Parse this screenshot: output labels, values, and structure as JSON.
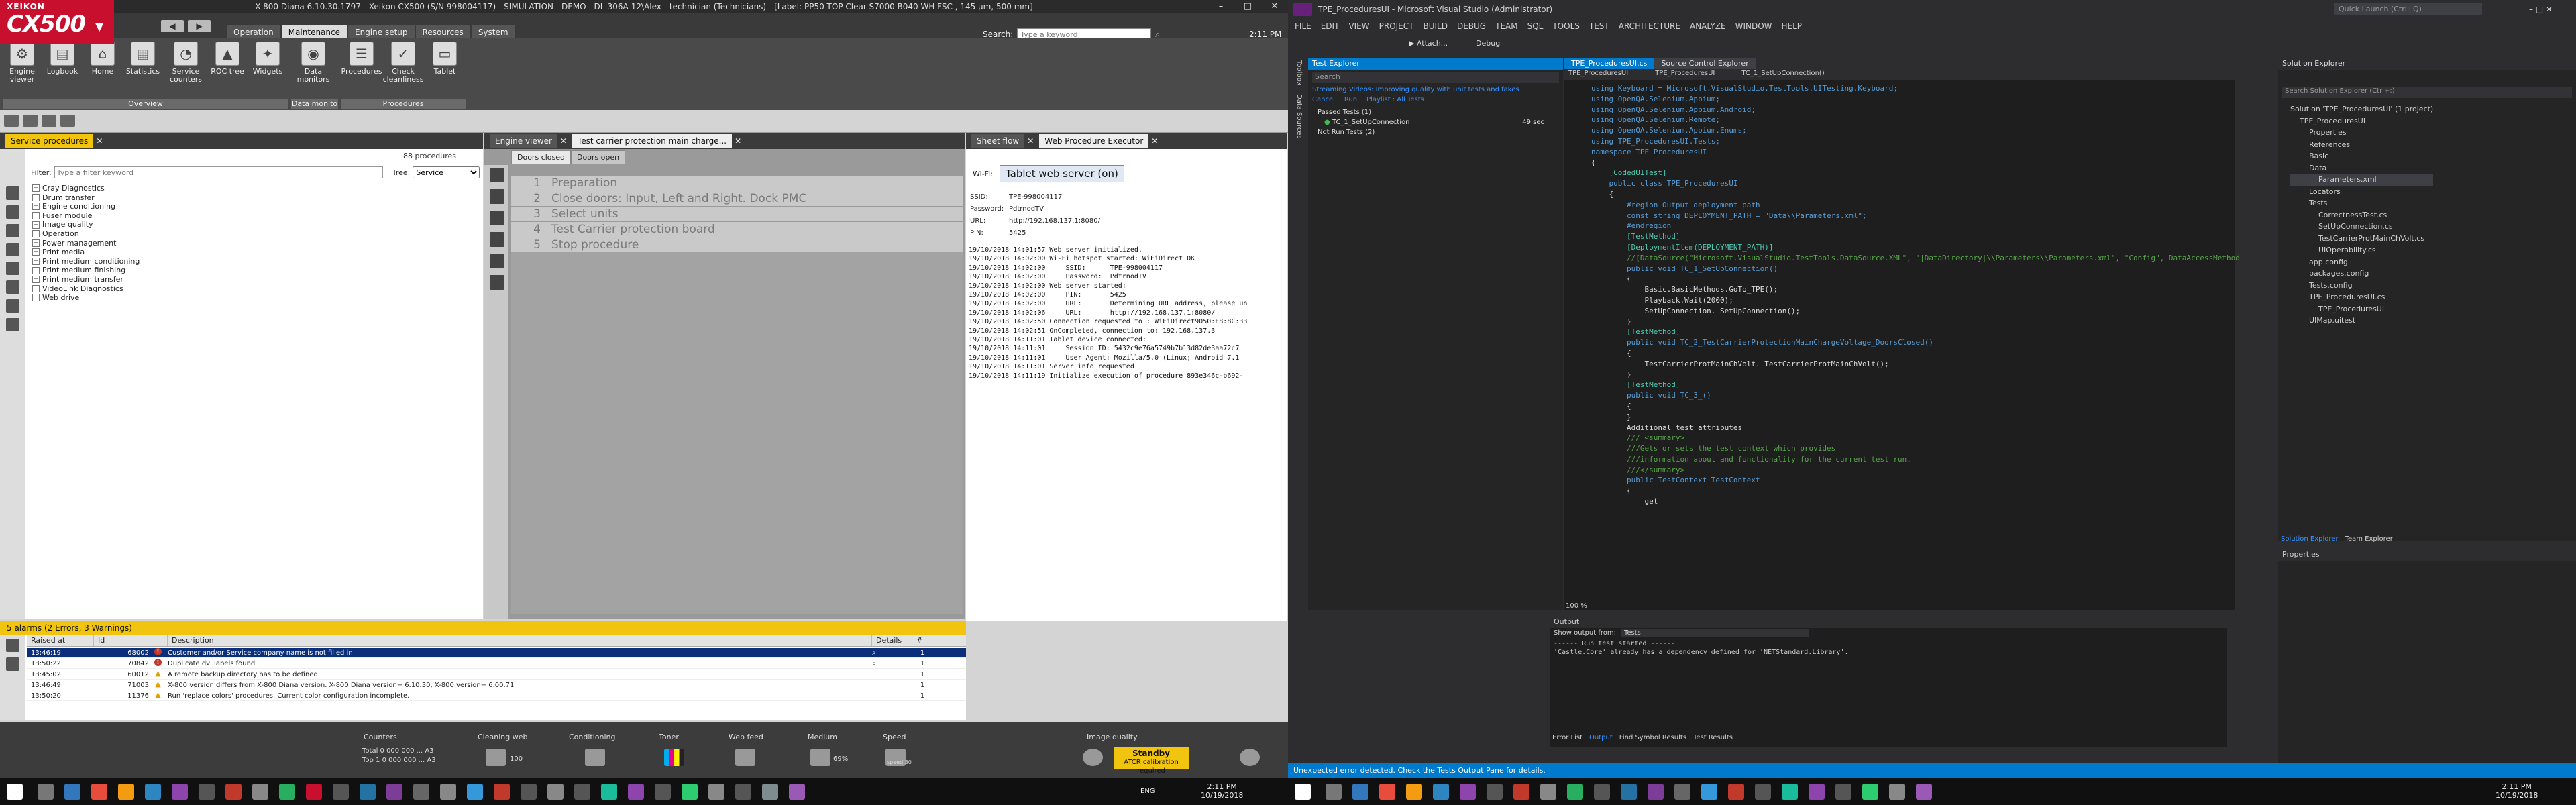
{
  "left_app": {
    "logo": {
      "brand": "XEIKON",
      "model": "CX500"
    },
    "title": "X-800 Diana 6.10.30.1797 - Xeikon CX500 (S/N 998004117) - SIMULATION - DEMO - DL-306A-12\\Alex - technician (Technicians) - [Label: PP50 TOP Clear S7000 B040 WH FSC , 145 µm, 500 mm]",
    "menu_tabs": [
      "Operation",
      "Maintenance",
      "Engine setup",
      "Resources",
      "System"
    ],
    "search_label": "Search:",
    "search_placeholder": "Type a keyword",
    "clock": "2:11 PM",
    "ribbon": [
      {
        "label": "Engine viewer",
        "icon": "engine-icon"
      },
      {
        "label": "Logbook",
        "icon": "logbook-icon"
      },
      {
        "label": "Home",
        "icon": "home-icon"
      },
      {
        "label": "Statistics",
        "icon": "statistics-icon"
      },
      {
        "label": "Service counters",
        "icon": "counter-icon"
      },
      {
        "label": "ROC tree",
        "icon": "tree-icon"
      },
      {
        "label": "Widgets",
        "icon": "widgets-icon"
      },
      {
        "label": "Data monitors",
        "icon": "monitor-icon"
      },
      {
        "label": "Procedures",
        "icon": "procedures-icon"
      },
      {
        "label": "Check cleanliness",
        "icon": "check-icon"
      },
      {
        "label": "Tablet",
        "icon": "tablet-icon"
      }
    ],
    "ribbon_groups": [
      "Overview",
      "Data monito",
      "Procedures"
    ],
    "service_panel": {
      "title": "Service procedures",
      "count": "88 procedures",
      "filter_label": "Filter:",
      "filter_placeholder": "Type a filter keyword",
      "tree_label": "Tree:",
      "tree_value": "Service",
      "items": [
        "Cray Diagnostics",
        "Drum transfer",
        "Engine conditioning",
        "Fuser module",
        "Image quality",
        "Operation",
        "Power management",
        "Print media",
        "Print medium conditioning",
        "Print medium finishing",
        "Print medium transfer",
        "VideoLink Diagnostics",
        "Web drive"
      ]
    },
    "engine_panel": {
      "tabs": [
        "Engine viewer",
        "Test carrier protection main charge..."
      ],
      "subtabs": [
        "Doors closed",
        "Doors open"
      ],
      "steps": [
        {
          "n": "1",
          "text": "Preparation"
        },
        {
          "n": "2",
          "text": "Close doors: Input, Left and Right. Dock PMC"
        },
        {
          "n": "3",
          "text": "Select units"
        },
        {
          "n": "4",
          "text": "Test Carrier protection board"
        },
        {
          "n": "5",
          "text": "Stop procedure"
        }
      ]
    },
    "web_panel": {
      "tabs": [
        "Sheet flow",
        "Web Procedure Executor"
      ],
      "wifi_label": "Wi-Fi:",
      "wifi_button": "Tablet web server (on)",
      "fields": [
        {
          "k": "SSID:",
          "v": "TPE-998004117"
        },
        {
          "k": "Password:",
          "v": "PdtrnodTV"
        },
        {
          "k": "URL:",
          "v": "http://192.168.137.1:8080/"
        },
        {
          "k": "PIN:",
          "v": "5425"
        }
      ],
      "log": [
        "19/10/2018 14:01:57 Web server initialized.",
        "19/10/2018 14:02:00 Wi-Fi hotspot started: WiFiDirect OK",
        "19/10/2018 14:02:00     SSID:      TPE-998004117",
        "19/10/2018 14:02:00     Password:  PdtrnodTV",
        "19/10/2018 14:02:00 Web server started:",
        "19/10/2018 14:02:00     PIN:       5425",
        "19/10/2018 14:02:00     URL:       Determining URL address, please un",
        "19/10/2018 14:02:06     URL:       http://192.168.137.1:8080/",
        "19/10/2018 14:02:50 Connection requested to : WiFiDirect9050:F8:8C:33",
        "19/10/2018 14:02:51 OnCompleted, connection to: 192.168.137.3",
        "19/10/2018 14:11:01 Tablet device connected:",
        "19/10/2018 14:11:01     Session ID: 5432c9e76a5749b7b13d82de3aa72c7",
        "19/10/2018 14:11:01     User Agent: Mozilla/5.0 (Linux; Android 7.1",
        "19/10/2018 14:11:01 Server info requested",
        "19/10/2018 14:11:19 Initialize execution of procedure 893e346c-b692-"
      ]
    },
    "alarms": {
      "header": "5 alarms (2 Errors, 3 Warnings)",
      "columns": [
        "Raised at",
        "Id",
        "Description",
        "Details",
        "#"
      ],
      "rows": [
        {
          "time": "13:46:19",
          "id": "68002",
          "type": "error",
          "desc": "Customer and/or Service company name is not filled in",
          "n": "1"
        },
        {
          "time": "13:50:22",
          "id": "70842",
          "type": "error",
          "desc": "Duplicate dvl labels found",
          "n": "1"
        },
        {
          "time": "13:45:02",
          "id": "60012",
          "type": "warning",
          "desc": "A remote backup directory has to be defined",
          "n": "1"
        },
        {
          "time": "13:46:49",
          "id": "71003",
          "type": "warning",
          "desc": "X-800 version differs from X-800 Diana version. X-800 Diana version= 6.10.30, X-800 version= 6.00.71",
          "n": "1"
        },
        {
          "time": "13:50:20",
          "id": "11376",
          "type": "warning",
          "desc": "Run 'replace colors' procedures. Current color configuration incomplete.",
          "n": "1"
        }
      ]
    },
    "statusbar": {
      "counters_label": "Counters",
      "counters_total": "Total 0 000 000 ... A3",
      "counters_top": "Top 1 0 000 000 ... A3",
      "labels": [
        "Cleaning web",
        "Conditioning",
        "Toner",
        "Web feed",
        "Medium",
        "Speed",
        "Image quality"
      ],
      "cleaning_value": "100",
      "medium_value": "69%",
      "speed_value": "speed 30",
      "standby_title": "Standby",
      "standby_sub": "ATCR calibration required"
    }
  },
  "vs_app": {
    "title": "TPE_ProceduresUI - Microsoft Visual Studio (Administrator)",
    "quick_launch": "Quick Launch (Ctrl+Q)",
    "menu": [
      "FILE",
      "EDIT",
      "VIEW",
      "PROJECT",
      "BUILD",
      "DEBUG",
      "TEAM",
      "SQL",
      "TOOLS",
      "TEST",
      "ARCHITECTURE",
      "ANALYZE",
      "WINDOW",
      "HELP"
    ],
    "toolbar_attach": "Attach...",
    "toolbar_config": "Debug",
    "side_labels": [
      "Toolbox",
      "Data Sources"
    ],
    "test_explorer": {
      "title": "Test Explorer",
      "search": "Search",
      "banner": "Streaming Videos: Improving quality with unit tests and fakes",
      "actions": [
        "Cancel",
        "Run",
        "Playlist : All Tests"
      ],
      "passed": "Passed Tests (1)",
      "test_name": "TC_1_SetUpConnection",
      "test_time": "49 sec",
      "not_run": "Not Run Tests (2)"
    },
    "editor_tabs": [
      "TPE_ProceduresUI.cs",
      "Source Control Explorer"
    ],
    "editor_nav": [
      "TPE_ProceduresUI",
      "TPE_ProceduresUI",
      "TC_1_SetUpConnection()"
    ],
    "code": [
      "using Keyboard = Microsoft.VisualStudio.TestTools.UITesting.Keyboard;",
      "using OpenQA.Selenium.Appium;",
      "using OpenQA.Selenium.Appium.Android;",
      "using OpenQA.Selenium.Remote;",
      "using OpenQA.Selenium.Appium.Enums;",
      "using TPE_ProceduresUI.Tests;",
      "",
      "namespace TPE_ProceduresUI",
      "{",
      "",
      "    [CodedUITest]",
      "    public class TPE_ProceduresUI",
      "    {",
      "        #region Output deployment path",
      "        const string DEPLOYMENT_PATH = \"Data\\\\Parameters.xml\";",
      "        #endregion",
      "",
      "        [TestMethod]",
      "        [DeploymentItem(DEPLOYMENT_PATH)]",
      "        //[DataSource(\"Microsoft.VisualStudio.TestTools.DataSource.XML\", \"|DataDirectory|\\\\Parameters\\\\Parameters.xml\", \"Config\", DataAccessMethod",
      "        public void TC_1_SetUpConnection()",
      "        {",
      "            Basic.BasicMethods.GoTo_TPE();",
      "            Playback.Wait(2000);",
      "            SetUpConnection._SetUpConnection();",
      "        }",
      "",
      "        [TestMethod]",
      "        public void TC_2_TestCarrierProtectionMainChargeVoltage_DoorsClosed()",
      "        {",
      "            TestCarrierProtMainChVolt._TestCarrierProtMainChVolt();",
      "        }",
      "",
      "        [TestMethod]",
      "        public void TC_3_()",
      "        {",
      "",
      "        }",
      "",
      "        Additional test attributes",
      "",
      "        /// <summary>",
      "        ///Gets or sets the test context which provides",
      "        ///information about and functionality for the current test run.",
      "        ///</summary>",
      "        public TestContext TestContext",
      "        {",
      "            get"
    ],
    "zoom": "100 %",
    "output": {
      "title": "Output",
      "show_from_label": "Show output from:",
      "show_from_value": "Tests",
      "lines": [
        "------ Run test started ------",
        "'Castle.Core' already has a dependency defined for 'NETStandard.Library'."
      ],
      "tabs": [
        "Error List",
        "Output",
        "Find Symbol Results",
        "Test Results"
      ]
    },
    "solution_explorer": {
      "title": "Solution Explorer",
      "search": "Search Solution Explorer (Ctrl+;)",
      "items": [
        {
          "t": "Solution 'TPE_ProceduresUI' (1 project)",
          "d": 0
        },
        {
          "t": "TPE_ProceduresUI",
          "d": 1
        },
        {
          "t": "Properties",
          "d": 2
        },
        {
          "t": "References",
          "d": 2
        },
        {
          "t": "Basic",
          "d": 2
        },
        {
          "t": "Data",
          "d": 2
        },
        {
          "t": "Parameters.xml",
          "d": 3
        },
        {
          "t": "Locators",
          "d": 2
        },
        {
          "t": "Tests",
          "d": 2
        },
        {
          "t": "CorrectnessTest.cs",
          "d": 3
        },
        {
          "t": "SetUpConnection.cs",
          "d": 3
        },
        {
          "t": "TestCarrierProtMainChVolt.cs",
          "d": 3
        },
        {
          "t": "UIOperability.cs",
          "d": 3
        },
        {
          "t": "app.config",
          "d": 2
        },
        {
          "t": "packages.config",
          "d": 2
        },
        {
          "t": "Tests.config",
          "d": 2
        },
        {
          "t": "TPE_ProceduresUI.cs",
          "d": 2
        },
        {
          "t": "TPE_ProceduresUI",
          "d": 3
        },
        {
          "t": "UIMap.uitest",
          "d": 2
        }
      ],
      "bottom_tabs": [
        "Solution Explorer",
        "Team Explorer"
      ]
    },
    "properties_title": "Properties",
    "status": "Unexpected error detected. Check the Tests Output Pane for details."
  },
  "taskbar": {
    "left_clock_time": "2:11 PM",
    "left_clock_date": "10/19/2018",
    "left_lang": "ENG",
    "right_clock_time": "2:11 PM",
    "right_clock_date": "10/19/2018"
  }
}
